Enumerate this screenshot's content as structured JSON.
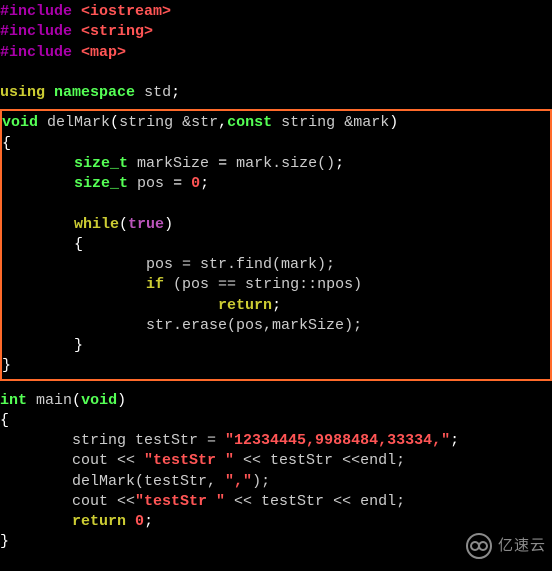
{
  "code": {
    "include1_kw": "#include",
    "include1_hdr": "<iostream>",
    "include2_kw": "#include",
    "include2_hdr": "<string>",
    "include3_kw": "#include",
    "include3_hdr": "<map>",
    "using_kw": "using",
    "namespace_kw": "namespace",
    "std_id": "std",
    "semi": ";",
    "void_kw": "void",
    "func1_name": "delMark",
    "lparen": "(",
    "rparen": ")",
    "string_type": "string",
    "amp_str": "&str",
    "comma": ",",
    "const_kw": "const",
    "amp_mark": "&mark",
    "lbrace": "{",
    "rbrace": "}",
    "size_t_kw": "size_t",
    "var_markSize": "markSize",
    "eq": " = ",
    "mark_size_call": "mark.size()",
    "var_pos": "pos",
    "zero": "0",
    "while_kw": "while",
    "true_kw": "true",
    "assign_find": "pos = str.find(mark);",
    "if_kw": "if",
    "cond": " (pos == string::npos)",
    "return_kw": "return",
    "erase_call": "str.erase(pos,markSize);",
    "int_kw": "int",
    "main_name": "main",
    "testStr_decl_lead": "string testStr = ",
    "testStr_literal": "\"12334445,9988484,33334,\"",
    "cout_line1_a": "cout << ",
    "cout_str1": "\"testStr \"",
    "cout_line1_b": " << testStr <<endl;",
    "delMark_call_a": "delMark(testStr, ",
    "delMark_arg": "\",\"",
    "delMark_call_b": ");",
    "cout_line2_a": "cout <<",
    "cout_str2": "\"testStr \"",
    "cout_line2_b": " << testStr << endl;",
    "return0": "return",
    "zero2": "0"
  },
  "watermark": {
    "label": "亿速云"
  }
}
